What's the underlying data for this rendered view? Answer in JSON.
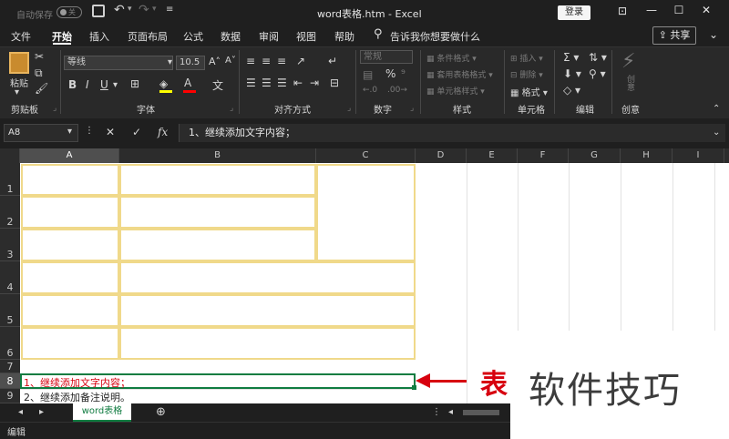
{
  "titlebar": {
    "autosave_label": "自动保存",
    "autosave_state": "关",
    "title": "word表格.htm  -  Excel",
    "login_label": "登录"
  },
  "menu": {
    "items": [
      "文件",
      "开始",
      "插入",
      "页面布局",
      "公式",
      "数据",
      "审阅",
      "视图",
      "帮助"
    ],
    "active": "开始",
    "tellme": "告诉我你想要做什么",
    "share_label": "共享"
  },
  "ribbon": {
    "clipboard": {
      "paste_label": "粘贴",
      "group_label": "剪贴板"
    },
    "font": {
      "font_name": "等线",
      "font_size": "10.5",
      "group_label": "字体"
    },
    "alignment": {
      "group_label": "对齐方式"
    },
    "number": {
      "format": "常规",
      "group_label": "数字"
    },
    "styles": {
      "conditional": "条件格式",
      "table_format": "套用表格格式",
      "cell_styles": "单元格样式",
      "group_label": "样式"
    },
    "cells": {
      "insert": "插入",
      "delete": "删除",
      "format": "格式",
      "group_label": "单元格"
    },
    "editing": {
      "group_label": "编辑"
    },
    "ideas": {
      "label": "创意",
      "group_label": "创意"
    }
  },
  "formula_bar": {
    "name_box": "A8",
    "formula": "1、继续添加文字内容；"
  },
  "grid": {
    "columns": [
      "A",
      "B",
      "C",
      "D",
      "E",
      "F",
      "G",
      "H",
      "I"
    ],
    "rows": [
      "1",
      "2",
      "3",
      "4",
      "5",
      "6",
      "7",
      "8",
      "9"
    ],
    "selected_column": "A",
    "selected_row": "8",
    "cell_a8": "1、继续添加文字内容；",
    "cell_a9": "2、继续添加备注说明。"
  },
  "sheet_tabs": {
    "tabs": [
      "word表格"
    ],
    "add_icon": "plus-circle-icon"
  },
  "statusbar": {
    "mode": "编辑"
  },
  "overlay": {
    "caption": "表",
    "watermark": "软件技巧",
    "accent_color": "#d7000f"
  }
}
